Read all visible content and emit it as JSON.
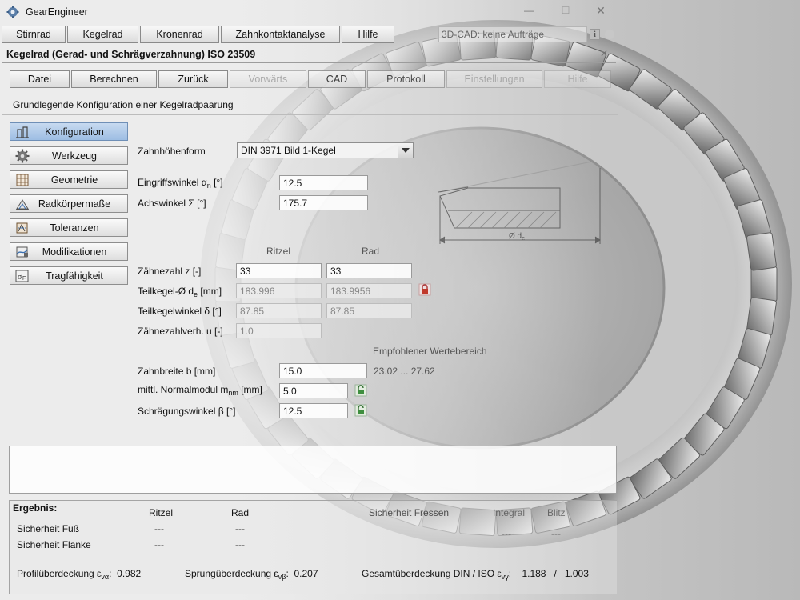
{
  "window": {
    "title": "GearEngineer",
    "minimize": "—",
    "maximize": "☐",
    "close": "✕"
  },
  "main_tabs": [
    {
      "label": "Stirnrad"
    },
    {
      "label": "Kegelrad"
    },
    {
      "label": "Kronenrad"
    },
    {
      "label": "Zahnkontaktanalyse"
    },
    {
      "label": "Hilfe"
    }
  ],
  "cad_status": "3D-CAD: keine Aufträge",
  "panel": {
    "title": "Kegelrad (Gerad- und Schrägverzahnung) ISO 23509",
    "close": "✕"
  },
  "toolbar": [
    {
      "label": "Datei"
    },
    {
      "label": "Berechnen"
    },
    {
      "label": "Zurück"
    },
    {
      "label": "Vorwärts"
    },
    {
      "label": "CAD"
    },
    {
      "label": "Protokoll"
    },
    {
      "label": "Einstellungen"
    },
    {
      "label": "Hilfe"
    }
  ],
  "section_title": "Grundlegende Konfiguration einer Kegelradpaarung",
  "sidebar": [
    {
      "label": "Konfiguration",
      "icon": "config-icon"
    },
    {
      "label": "Werkzeug",
      "icon": "tool-gear-icon"
    },
    {
      "label": "Geometrie",
      "icon": "geometry-grid-icon"
    },
    {
      "label": "Radkörpermaße",
      "icon": "wheel-body-icon"
    },
    {
      "label": "Toleranzen",
      "icon": "tolerance-icon"
    },
    {
      "label": "Modifikationen",
      "icon": "modification-icon"
    },
    {
      "label": "Tragfähigkeit",
      "icon": "load-capacity-icon"
    }
  ],
  "form": {
    "tooth_height_label": "Zahnhöhenform",
    "tooth_height_value": "DIN 3971 Bild 1-Kegel",
    "pressure_angle_label": "Eingriffswinkel α",
    "pressure_angle_sub": "n",
    "pressure_angle_unit": " [°]",
    "pressure_angle_value": "12.5",
    "shaft_angle_label": "Achswinkel Σ [°]",
    "shaft_angle_value": "175.7",
    "col_pinion": "Ritzel",
    "col_wheel": "Rad",
    "teeth_label": "Zähnezahl z [-]",
    "teeth_pinion": "33",
    "teeth_wheel": "33",
    "pitch_dia_label": "Teilkegel-Ø d",
    "pitch_dia_sub": "e",
    "pitch_dia_unit": " [mm]",
    "pitch_dia_pinion": "183.996",
    "pitch_dia_wheel": "183.9956",
    "pitch_angle_label": "Teilkegelwinkel δ [°]",
    "pitch_angle_pinion": "87.85",
    "pitch_angle_wheel": "87.85",
    "ratio_label": "Zähnezahlverh. u [-]",
    "ratio_value": "1.0",
    "recommended_label": "Empfohlener Wertebereich",
    "face_width_label": "Zahnbreite b [mm]",
    "face_width_value": "15.0",
    "face_width_range": "23.02 ... 27.62",
    "module_label": "mittl. Normalmodul m",
    "module_sub": "nm",
    "module_unit": " [mm]",
    "module_value": "5.0",
    "helix_label": "Schrägungswinkel β [°]",
    "helix_value": "12.5"
  },
  "results": {
    "title": "Ergebnis:",
    "col_pinion": "Ritzel",
    "col_wheel": "Rad",
    "col_scuffing": "Sicherheit Fressen",
    "col_integral": "Integral",
    "col_flash": "Blitz",
    "row_root": "Sicherheit Fuß",
    "row_flank": "Sicherheit Flanke",
    "root_pinion": "---",
    "root_wheel": "---",
    "flank_pinion": "---",
    "flank_wheel": "---",
    "scuff_integral": "---",
    "scuff_flash": "---",
    "profile_contact_label": "Profilüberdeckung ε",
    "profile_contact_sub": "vα",
    "profile_contact_value": "0.982",
    "face_contact_label": "Sprungüberdeckung ε",
    "face_contact_sub": "vβ",
    "face_contact_value": "0.207",
    "total_contact_label": "Gesamtüberdeckung DIN / ISO ε",
    "total_contact_sub": "vγ",
    "total_contact_din": "1.188",
    "total_contact_sep": "/",
    "total_contact_iso": "1.003"
  },
  "diagram": {
    "dim_label": "Ø d",
    "dim_sub": "e"
  },
  "colors": {
    "accent": "#9dbde3",
    "lock": "#3f8f3f",
    "lock_red": "#c0392b"
  }
}
